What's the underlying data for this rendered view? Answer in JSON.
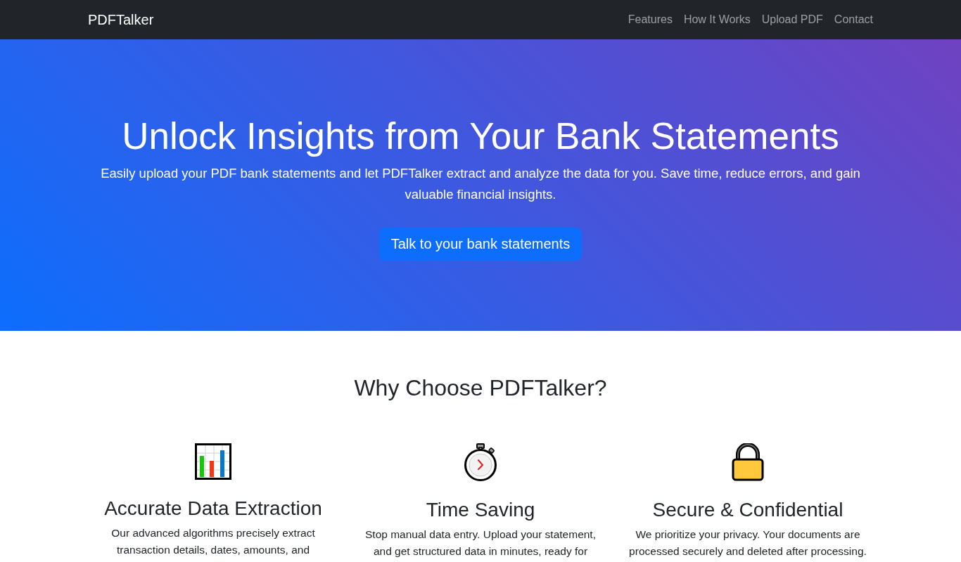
{
  "navbar": {
    "brand": "PDFTalker",
    "links": [
      "Features",
      "How It Works",
      "Upload PDF",
      "Contact"
    ]
  },
  "hero": {
    "title": "Unlock Insights from Your Bank Statements",
    "text": "Easily upload your PDF bank statements and let PDFTalker extract and analyze the data for you. Save time, reduce errors, and gain valuable financial insights.",
    "button": "Talk to your bank statements"
  },
  "features": {
    "title": "Why Choose PDFTalker?",
    "items": [
      {
        "kind": "chart",
        "title": "Accurate Data Extraction",
        "text": "Our advanced algorithms precisely extract transaction details, dates, amounts, and"
      },
      {
        "kind": "stopwatch",
        "title": "Time Saving",
        "text": "Stop manual data entry. Upload your statement, and get structured data in minutes, ready for"
      },
      {
        "kind": "lock",
        "title": "Secure & Confidential",
        "text": "We prioritize your privacy. Your documents are processed securely and deleted after processing."
      }
    ]
  }
}
